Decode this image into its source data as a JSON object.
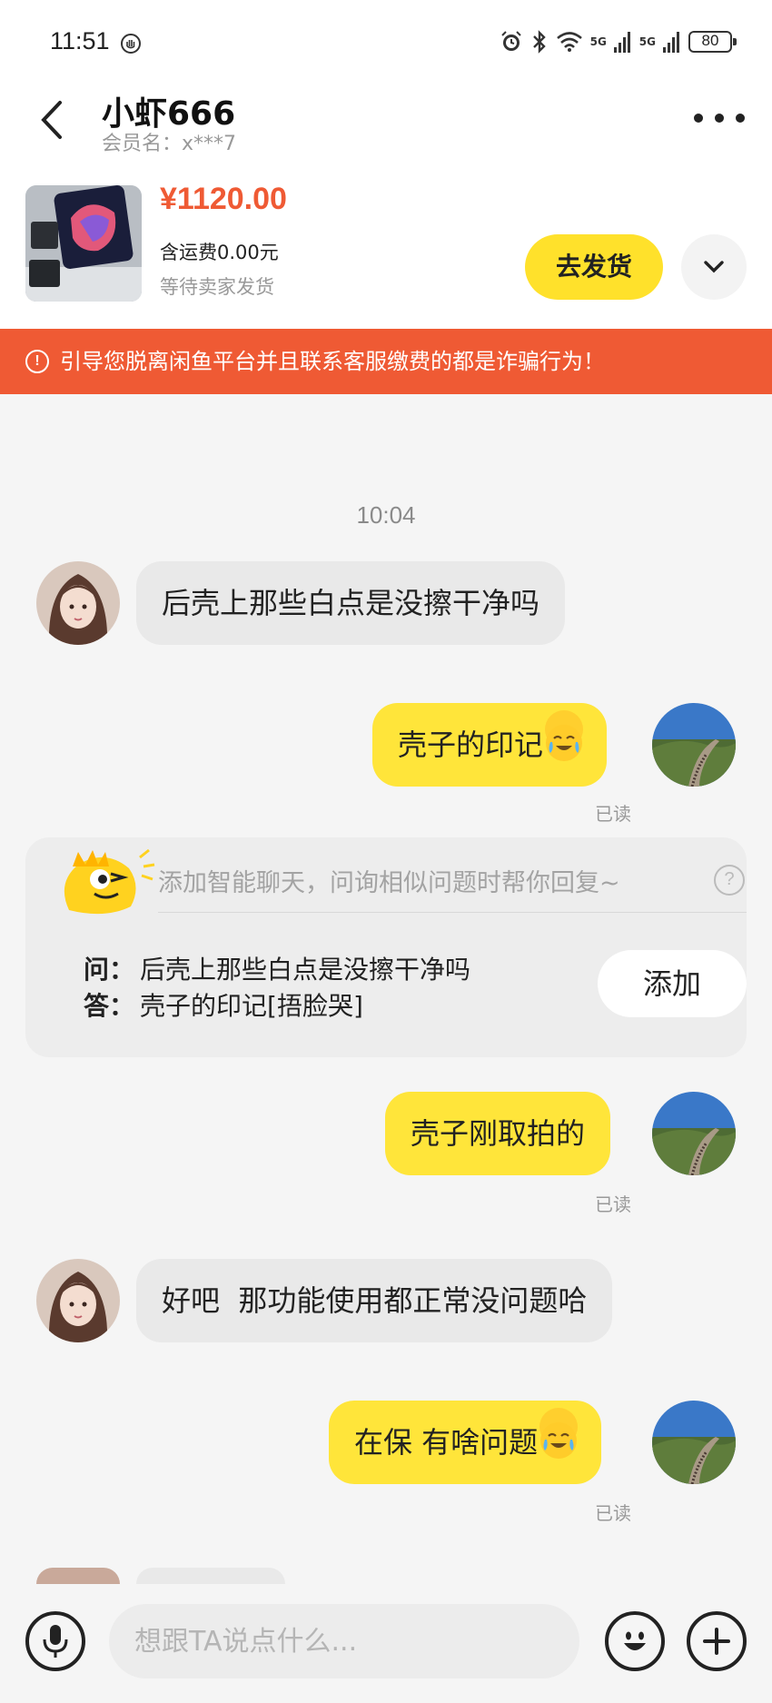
{
  "status_bar": {
    "time": "11:51",
    "battery": "80",
    "network_1": "5G",
    "network_2": "5G"
  },
  "header": {
    "title": "小虾666",
    "member": "会员名：x***7"
  },
  "product": {
    "price": "¥1120.00",
    "shipping": "含运费0.00元",
    "status": "等待卖家发货",
    "ship_button": "去发货"
  },
  "warning": {
    "text": "引导您脱离闲鱼平台并且联系客服缴费的都是诈骗行为！"
  },
  "chat": {
    "timestamp": "10:04",
    "messages": [
      {
        "side": "in",
        "text": "后壳上那些白点是没擦干净吗"
      },
      {
        "side": "out",
        "text": "壳子的印记",
        "read": "已读"
      },
      {
        "side": "out",
        "text": "壳子刚取拍的",
        "read": "已读"
      },
      {
        "side": "in",
        "text": "好吧  那功能使用都正常没问题哈"
      },
      {
        "side": "out",
        "text": "在保 有啥问题",
        "read": "已读"
      }
    ]
  },
  "smart_reply": {
    "hint": "添加智能聊天，问询相似问题时帮你回复~",
    "q_label": "问：",
    "question": "后壳上那些白点是没擦干净吗",
    "a_label": "答：",
    "answer": "壳子的印记[捂脸哭]",
    "add_button": "添加"
  },
  "input": {
    "placeholder": "想跟TA说点什么..."
  }
}
